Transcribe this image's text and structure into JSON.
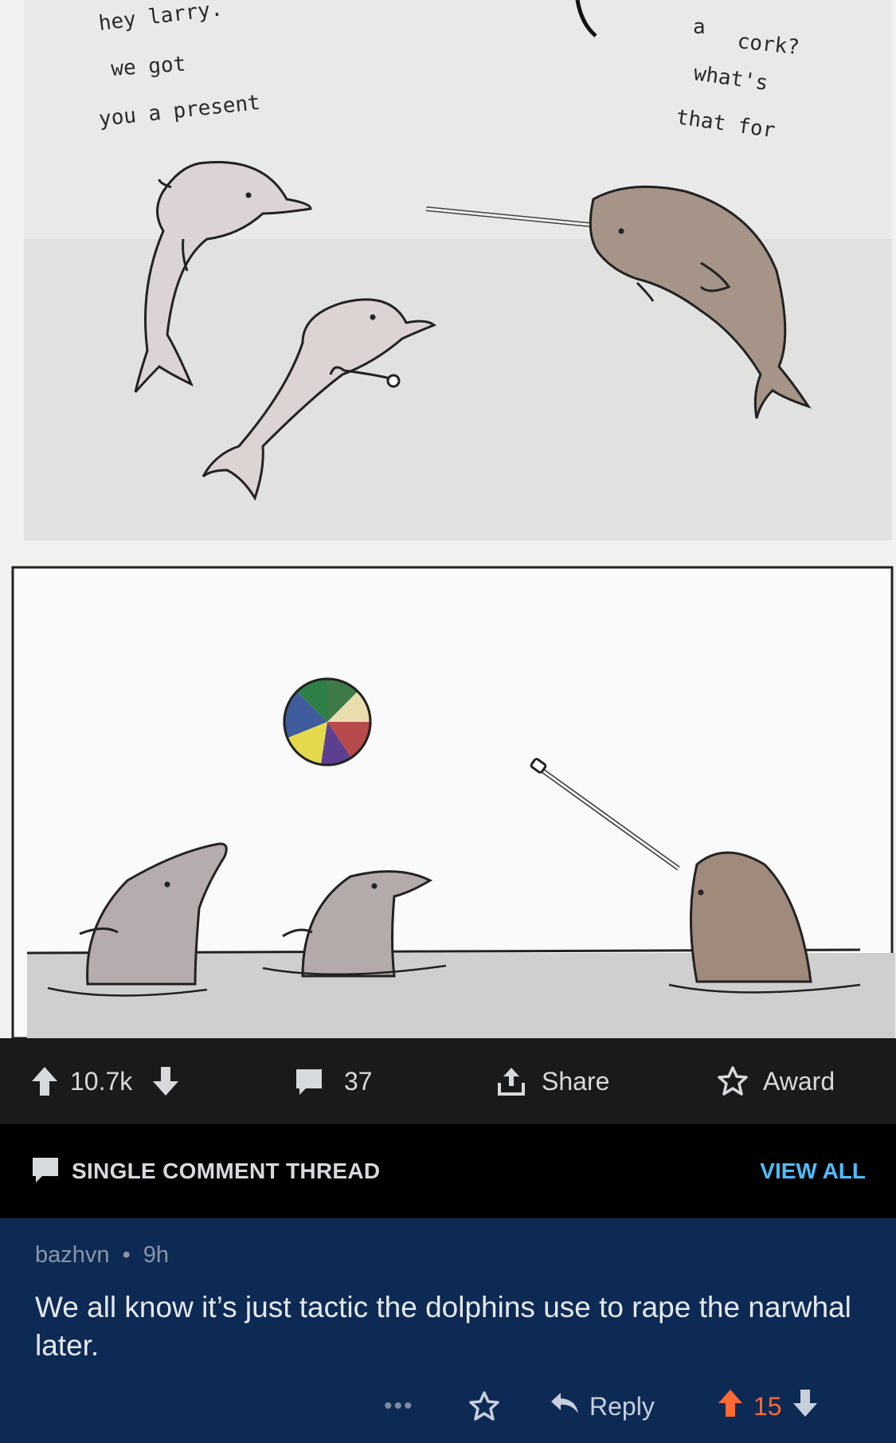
{
  "comic": {
    "panel1": {
      "speech_left": [
        "hey larry.",
        "we got",
        "you a present"
      ],
      "speech_right": [
        "a",
        "cork?",
        "what's",
        "that for"
      ]
    }
  },
  "post_actions": {
    "upvotes": "10.7k",
    "comments": "37",
    "share_label": "Share",
    "award_label": "Award"
  },
  "thread": {
    "title": "SINGLE COMMENT THREAD",
    "view_all": "VIEW ALL"
  },
  "comment": {
    "author": "bazhvn",
    "separator": "•",
    "age": "9h",
    "text": "We all know it’s just tactic the dolphins use to rape the narwhal later.",
    "more": "•••",
    "reply_label": "Reply",
    "score": "15"
  },
  "colors": {
    "action_bar_bg": "#1a1a1b",
    "thread_bar_bg": "#000000",
    "comment_bg": "#0d2a55",
    "link_blue": "#4fbcff",
    "upvote_orange": "#ff6a33"
  },
  "icons": [
    "upvote-icon",
    "downvote-icon",
    "comment-icon",
    "share-icon",
    "award-icon",
    "more-icon",
    "reply-icon"
  ]
}
